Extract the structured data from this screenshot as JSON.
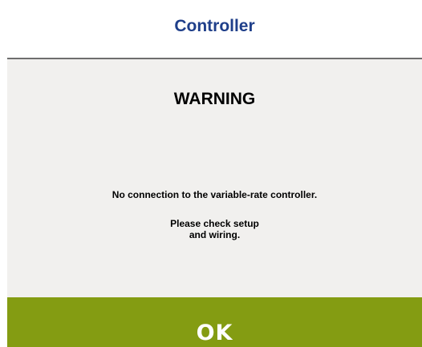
{
  "header": {
    "title": "Controller"
  },
  "warning": {
    "title": "WARNING",
    "message_line1": "No connection to the variable-rate controller.",
    "message_line2": "Please check setup",
    "message_line3": "and wiring."
  },
  "actions": {
    "ok_label": "OK"
  },
  "colors": {
    "header_title": "#1f3f8a",
    "background": "#f1f0ee",
    "ok_button": "#849c12"
  }
}
